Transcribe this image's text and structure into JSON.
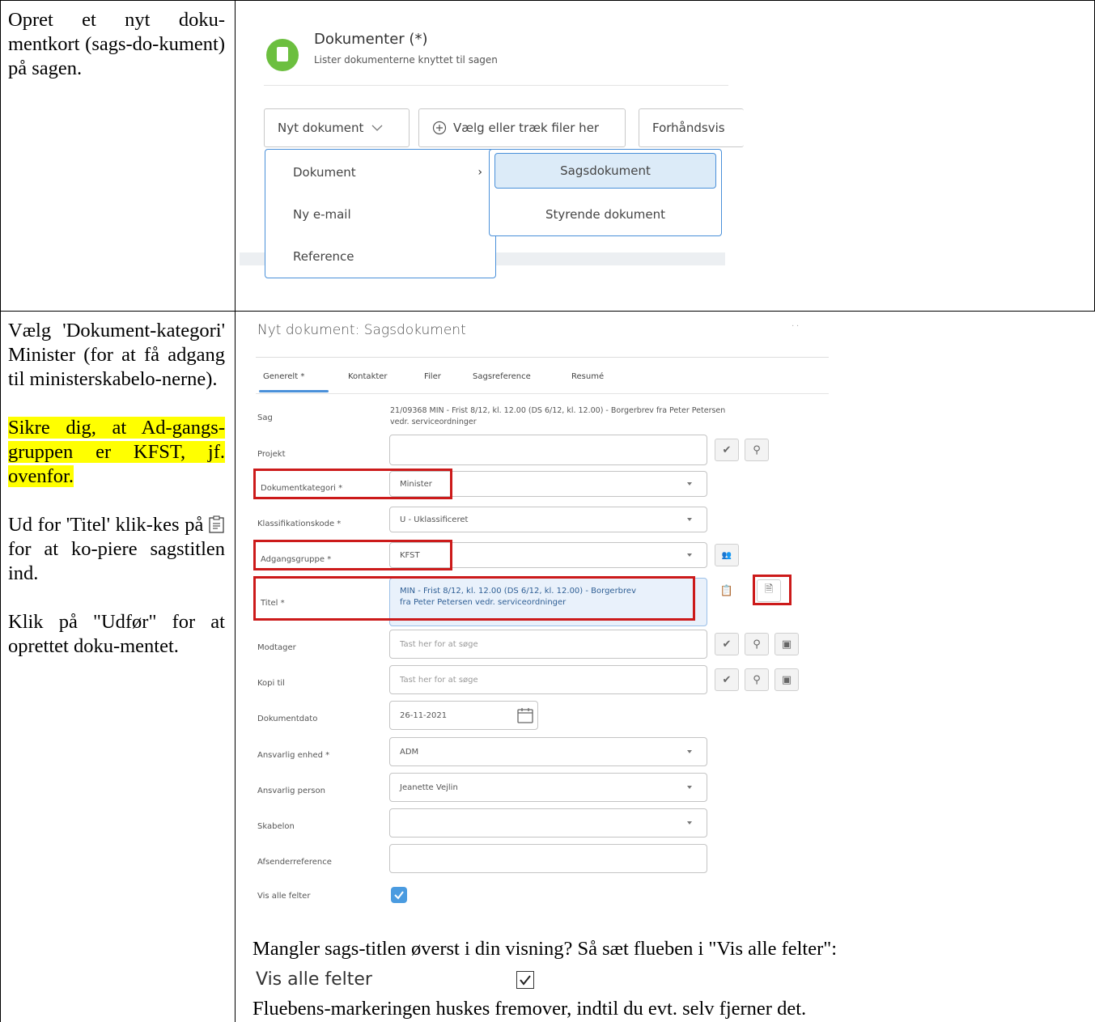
{
  "row1": {
    "instruction": "Opret et nyt doku-mentkort (sags-do-kument) på sagen."
  },
  "top_ui": {
    "header_title": "Dokumenter (*)",
    "header_subtitle": "Lister dokumenterne knyttet til sagen",
    "new_doc_button": "Nyt dokument",
    "choose_files_button": "Vælg eller træk filer her",
    "preview_button": "Forhåndsvis",
    "menu": [
      "Dokument",
      "Ny e-mail",
      "Reference"
    ],
    "submenu": [
      "Sagsdokument",
      "Styrende dokument"
    ]
  },
  "row2": {
    "para1": "Vælg 'Dokument-kategori' Minister (for at få adgang til ministerskabelo-nerne).",
    "para2_highlight": "Sikre dig, at Ad-gangs-gruppen er KFST, jf. ovenfor.",
    "para3_a": "Ud for 'Titel' klik-kes på",
    "para3_b": "for at ko-piere sagstitlen ind.",
    "para4": "Klik på \"Udfør\" for at oprettet doku-mentet."
  },
  "dialog": {
    "title": "Nyt dokument: Sagsdokument",
    "tabs": [
      "Generelt *",
      "Kontakter",
      "Filer",
      "Sagsreference",
      "Resumé"
    ],
    "sag_label": "Sag",
    "sag_value_line1": "21/09368 MIN - Frist 8/12, kl. 12.00 (DS 6/12, kl. 12.00) - Borgerbrev fra Peter Petersen",
    "sag_value_line2": "vedr. serviceordninger",
    "projekt_label": "Projekt",
    "dokumentkategori_label": "Dokumentkategori *",
    "dokumentkategori_value": "Minister",
    "klassifikation_label": "Klassifikationskode *",
    "klassifikation_value": "U - Uklassificeret",
    "adgangsgruppe_label": "Adgangsgruppe *",
    "adgangsgruppe_value": "KFST",
    "titel_label": "Titel *",
    "titel_value_line1": "MIN - Frist 8/12, kl. 12.00 (DS 6/12, kl. 12.00) - Borgerbrev",
    "titel_value_line2": "fra Peter Petersen vedr. serviceordninger",
    "modtager_label": "Modtager",
    "modtager_placeholder": "Tast her for at søge",
    "kopi_label": "Kopi til",
    "kopi_placeholder": "Tast her for at søge",
    "dokumentdato_label": "Dokumentdato",
    "dokumentdato_value": "26-11-2021",
    "ansvarlig_enhed_label": "Ansvarlig enhed *",
    "ansvarlig_enhed_value": "ADM",
    "ansvarlig_person_label": "Ansvarlig person",
    "ansvarlig_person_value": "Jeanette Vejlin",
    "skabelon_label": "Skabelon",
    "afsender_label": "Afsenderreference",
    "visalle_label": "Vis alle felter"
  },
  "footer": {
    "note": "Mangler sags-titlen øverst i din visning? Så sæt flueben i \"Vis alle felter\":",
    "vis_alle": "Vis alle felter",
    "remember": "Fluebens-markeringen huskes fremover, indtil du evt. selv fjerner det."
  }
}
